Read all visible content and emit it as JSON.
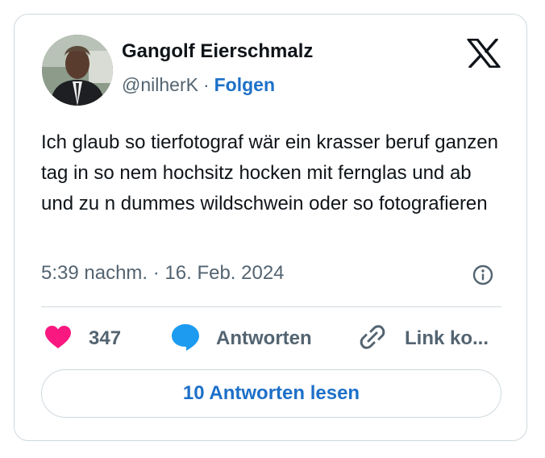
{
  "author": {
    "name": "Gangolf Eierschmalz",
    "handle": "@nilherK",
    "separator": "·",
    "follow_label": "Folgen"
  },
  "tweet": {
    "text": "Ich glaub so tierfotograf wär ein krasser beruf ganzen tag in so nem hochsitz hocken mit fernglas und ab und zu n dummes wildschwein oder so fotografieren",
    "timestamp": "5:39 nachm. · 16. Feb. 2024"
  },
  "actions": {
    "like_count": "347",
    "reply_label": "Antworten",
    "copy_link_label": "Link ko..."
  },
  "read_replies_label": "10 Antworten lesen",
  "colors": {
    "accent": "#1d70c8",
    "like": "#f91880",
    "reply_icon": "#1d9bf0",
    "secondary_text": "#536471",
    "border": "#cfd9de"
  },
  "icons": [
    "x-logo-icon",
    "info-icon",
    "heart-icon",
    "reply-bubble-icon",
    "link-icon"
  ]
}
